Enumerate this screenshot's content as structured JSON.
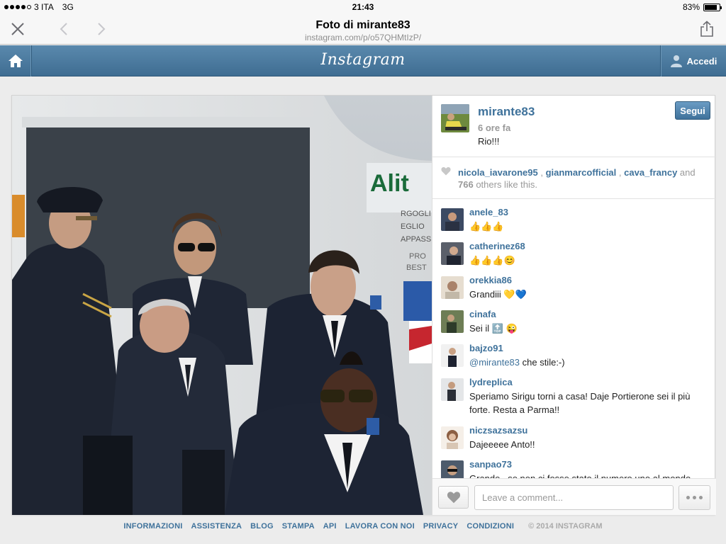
{
  "status_bar": {
    "carrier": "3 ITA",
    "network": "3G",
    "time": "21:43",
    "battery_text": "83%",
    "battery_level": 0.83,
    "signal_bars": 4
  },
  "browser": {
    "title": "Foto di mirante83",
    "url": "instagram.com/p/o57QHMtIzP/",
    "close_icon": "close-icon",
    "back_icon": "chevron-left-icon",
    "forward_icon": "chevron-right-icon",
    "share_icon": "share-icon"
  },
  "header": {
    "logo": "Instagram",
    "login_label": "Accedi",
    "home_icon": "home-icon",
    "user_icon": "user-icon"
  },
  "post": {
    "owner": "mirante83",
    "time_ago": "6 ore fa",
    "caption": "Rio!!!",
    "follow_label": "Segui",
    "likes": {
      "users": [
        "nicola_iavarone95",
        "gianmarcofficial",
        "cava_francy"
      ],
      "sep1": " , ",
      "sep2": " , ",
      "and_text": " and",
      "count": "766",
      "suffix": " others like this."
    },
    "comments": [
      {
        "user": "anele_83",
        "text": "",
        "emoji": [
          "👍",
          "👍",
          "👍"
        ]
      },
      {
        "user": "catherinez68",
        "text": "",
        "emoji": [
          "👍",
          "👍",
          "👍",
          "😊"
        ]
      },
      {
        "user": "orekkia86",
        "text": "Grandiii ",
        "emoji": [
          "💛",
          "💙"
        ]
      },
      {
        "user": "cinafa",
        "text": "Sei il ",
        "emoji": [
          "🔝",
          " ",
          "😜"
        ]
      },
      {
        "user": "bajzo91",
        "mention": "@mirante83",
        "text": " che stile:-)"
      },
      {
        "user": "lydreplica",
        "text": "Speriamo Sirigu torni a casa! Daje Portierone sei il più forte. Resta a Parma!!"
      },
      {
        "user": "niczsazsazsu",
        "text": "Dajeeeee Anto!!"
      },
      {
        "user": "sanpao73",
        "text": "Grande...se non ci fosse stato il numero uno al mondo"
      }
    ],
    "comment_placeholder": "Leave a comment..."
  },
  "footer": {
    "links": [
      "INFORMAZIONI",
      "ASSISTENZA",
      "BLOG",
      "STAMPA",
      "API",
      "LAVORA CON NOI",
      "PRIVACY",
      "CONDIZIONI"
    ],
    "copyright": "© 2014 INSTAGRAM"
  },
  "colors": {
    "header_blue": "#3f6d92",
    "link_blue": "#3f729b",
    "muted": "#999999"
  }
}
